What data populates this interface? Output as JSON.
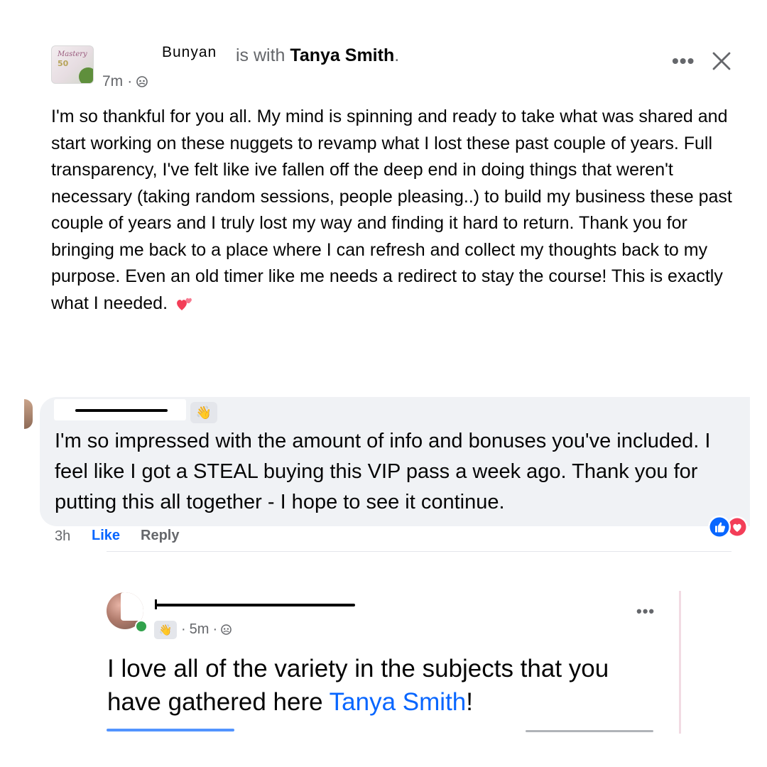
{
  "post": {
    "author_fragment": "Bunyan",
    "with_text": "is with",
    "tagged_name": "Tanya Smith",
    "period": ".",
    "time": "7m",
    "separator": "·",
    "body": "I'm so thankful for you all. My mind is spinning and ready to take what was shared and start working on these nuggets to revamp what I lost these past couple of years. Full transparency, I've felt like ive fallen off the deep end in doing things that weren't necessary (taking random sessions, people pleasing..) to build my business these past couple of years and I truly lost my way and finding it hard to return. Thank you for bringing me back to a place where I can refresh and collect my thoughts back to my purpose. Even an old timer like me needs a redirect to stay the course! This is exactly what I needed.",
    "more_label": "•••",
    "avatar_logo_word": "Mastery",
    "avatar_logo_num": "50"
  },
  "comment1": {
    "badge_icon": "👋",
    "text": "I'm so impressed with the amount of info and bonuses you've included. I feel like I got a STEAL buying this VIP pass a week ago. Thank you for putting this all together - I hope to see it continue.",
    "time": "3h",
    "like_label": "Like",
    "reply_label": "Reply"
  },
  "comment2": {
    "badge_icon": "👋",
    "time": "5m",
    "separator": "·",
    "text_before": "I love all of the variety in the subjects that you have gathered here ",
    "mention": "Tanya Smith",
    "text_after": "!",
    "more_label": "•••"
  },
  "colors": {
    "accent_blue": "#0866ff",
    "secondary_text": "#65676b",
    "bubble_bg": "#f0f2f5",
    "online_green": "#31a24c",
    "love_red": "#f33e58"
  }
}
